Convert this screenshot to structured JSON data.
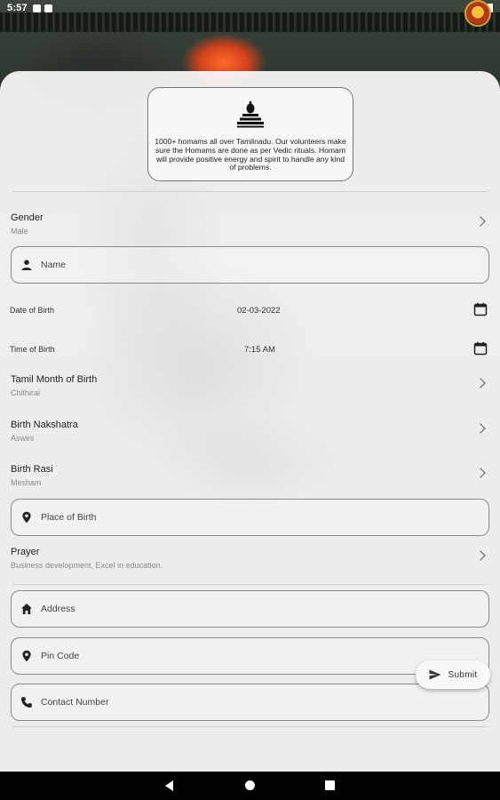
{
  "status_bar": {
    "time": "5:57"
  },
  "info_card": {
    "text": "1000+ homams all over Tamilnadu. Our volunteers make sure the Homams are done as per Vedic rituals. Homam will provide positive energy and spirit to handle any kind of problems."
  },
  "gender": {
    "label": "Gender",
    "value": "Male"
  },
  "name": {
    "placeholder": "Name"
  },
  "date_of_birth": {
    "label": "Date of Birth",
    "value": "02-03-2022"
  },
  "time_of_birth": {
    "label": "Time of Birth",
    "value": "7:15 AM"
  },
  "tamil_month": {
    "label": "Tamil Month of Birth",
    "value": "Chithirai"
  },
  "nakshatra": {
    "label": "Birth Nakshatra",
    "value": "Aswini"
  },
  "rasi": {
    "label": "Birth Rasi",
    "value": "Mesham"
  },
  "place_of_birth": {
    "placeholder": "Place of Birth"
  },
  "prayer": {
    "label": "Prayer",
    "value": "Business development, Excel in education."
  },
  "address": {
    "placeholder": "Address"
  },
  "pin_code": {
    "placeholder": "Pin Code"
  },
  "contact": {
    "placeholder": "Contact Number"
  },
  "submit": {
    "label": "Submit"
  }
}
